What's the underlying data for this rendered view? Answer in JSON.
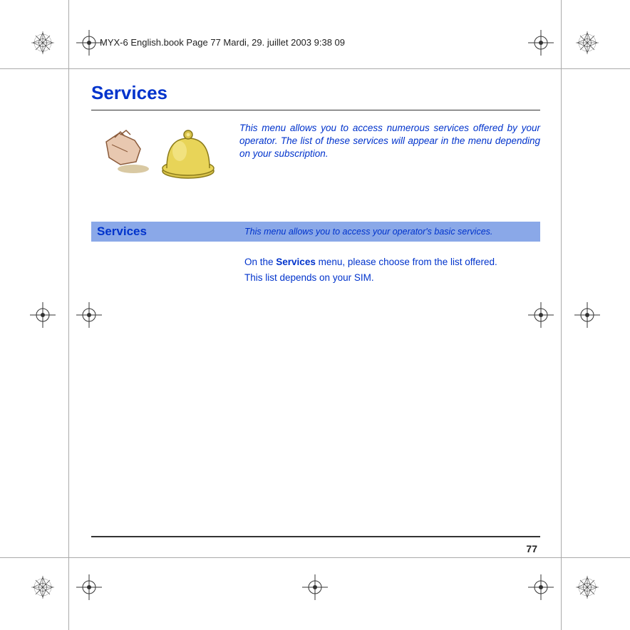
{
  "header": "MYX-6 English.book  Page 77  Mardi, 29. juillet 2003  9:38 09",
  "title": "Services",
  "intro": "This menu allows you to access numerous services offered by your operator. The list of these services will appear in the menu depending on your subscription.",
  "section": {
    "title": "Services",
    "description": "This menu allows you to access your operator's basic services."
  },
  "body": {
    "line1_pre": "On the ",
    "line1_bold": "Services",
    "line1_post": " menu, please choose from the list offered.",
    "line2": "This list depends on your SIM."
  },
  "page_number": "77",
  "icons": {
    "hand": "hand-icon",
    "bell": "bell-icon"
  }
}
